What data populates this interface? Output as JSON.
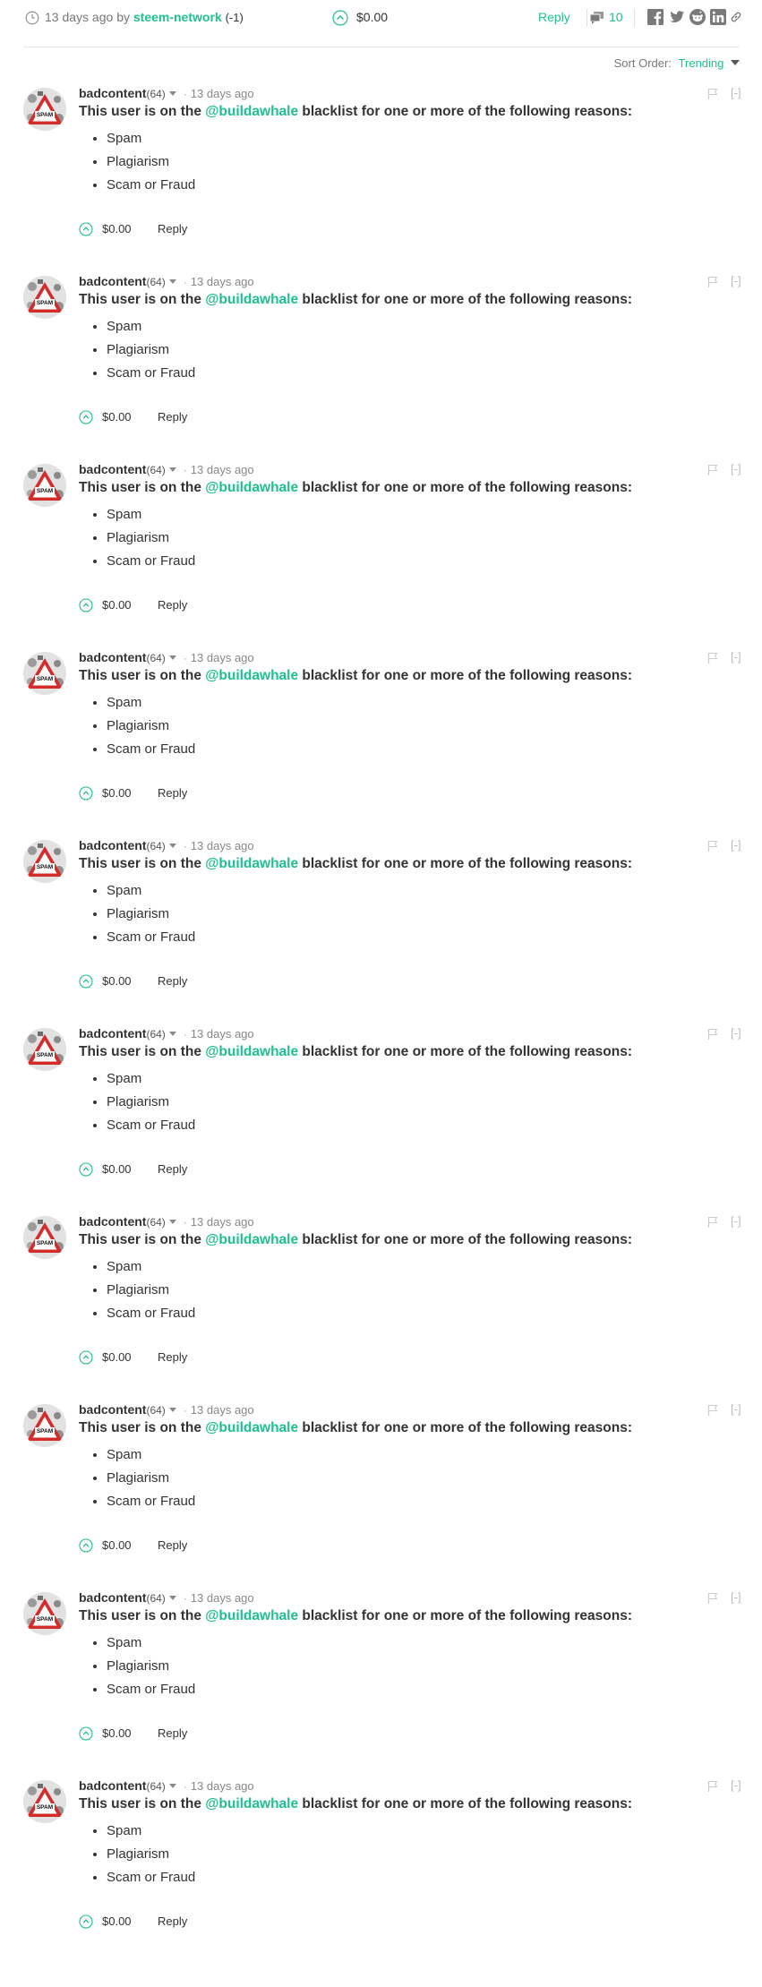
{
  "post_footer": {
    "time_ago": "13 days ago",
    "by_text": "by",
    "author": "steem-network",
    "author_rep": "(-1)",
    "payout": "$0.00",
    "reply_label": "Reply",
    "comment_count": "10"
  },
  "sort": {
    "label": "Sort Order:",
    "value": "Trending"
  },
  "colors": {
    "accent": "#1fbf8f",
    "text": "#333333",
    "muted": "#888888"
  },
  "comments": [
    {
      "author": "badcontent",
      "rep": "(64)",
      "date": "13 days ago",
      "collapse": "[-]",
      "text_before": "This user is on the",
      "mention": "@buildawhale",
      "text_after": "blacklist for one or more of the following reasons:",
      "reasons": [
        "Spam",
        "Plagiarism",
        "Scam or Fraud"
      ],
      "payout": "$0.00",
      "reply": "Reply"
    },
    {
      "author": "badcontent",
      "rep": "(64)",
      "date": "13 days ago",
      "collapse": "[-]",
      "text_before": "This user is on the",
      "mention": "@buildawhale",
      "text_after": "blacklist for one or more of the following reasons:",
      "reasons": [
        "Spam",
        "Plagiarism",
        "Scam or Fraud"
      ],
      "payout": "$0.00",
      "reply": "Reply"
    },
    {
      "author": "badcontent",
      "rep": "(64)",
      "date": "13 days ago",
      "collapse": "[-]",
      "text_before": "This user is on the",
      "mention": "@buildawhale",
      "text_after": "blacklist for one or more of the following reasons:",
      "reasons": [
        "Spam",
        "Plagiarism",
        "Scam or Fraud"
      ],
      "payout": "$0.00",
      "reply": "Reply"
    },
    {
      "author": "badcontent",
      "rep": "(64)",
      "date": "13 days ago",
      "collapse": "[-]",
      "text_before": "This user is on the",
      "mention": "@buildawhale",
      "text_after": "blacklist for one or more of the following reasons:",
      "reasons": [
        "Spam",
        "Plagiarism",
        "Scam or Fraud"
      ],
      "payout": "$0.00",
      "reply": "Reply"
    },
    {
      "author": "badcontent",
      "rep": "(64)",
      "date": "13 days ago",
      "collapse": "[-]",
      "text_before": "This user is on the",
      "mention": "@buildawhale",
      "text_after": "blacklist for one or more of the following reasons:",
      "reasons": [
        "Spam",
        "Plagiarism",
        "Scam or Fraud"
      ],
      "payout": "$0.00",
      "reply": "Reply"
    },
    {
      "author": "badcontent",
      "rep": "(64)",
      "date": "13 days ago",
      "collapse": "[-]",
      "text_before": "This user is on the",
      "mention": "@buildawhale",
      "text_after": "blacklist for one or more of the following reasons:",
      "reasons": [
        "Spam",
        "Plagiarism",
        "Scam or Fraud"
      ],
      "payout": "$0.00",
      "reply": "Reply"
    },
    {
      "author": "badcontent",
      "rep": "(64)",
      "date": "13 days ago",
      "collapse": "[-]",
      "text_before": "This user is on the",
      "mention": "@buildawhale",
      "text_after": "blacklist for one or more of the following reasons:",
      "reasons": [
        "Spam",
        "Plagiarism",
        "Scam or Fraud"
      ],
      "payout": "$0.00",
      "reply": "Reply"
    },
    {
      "author": "badcontent",
      "rep": "(64)",
      "date": "13 days ago",
      "collapse": "[-]",
      "text_before": "This user is on the",
      "mention": "@buildawhale",
      "text_after": "blacklist for one or more of the following reasons:",
      "reasons": [
        "Spam",
        "Plagiarism",
        "Scam or Fraud"
      ],
      "payout": "$0.00",
      "reply": "Reply"
    },
    {
      "author": "badcontent",
      "rep": "(64)",
      "date": "13 days ago",
      "collapse": "[-]",
      "text_before": "This user is on the",
      "mention": "@buildawhale",
      "text_after": "blacklist for one or more of the following reasons:",
      "reasons": [
        "Spam",
        "Plagiarism",
        "Scam or Fraud"
      ],
      "payout": "$0.00",
      "reply": "Reply"
    },
    {
      "author": "badcontent",
      "rep": "(64)",
      "date": "13 days ago",
      "collapse": "[-]",
      "text_before": "This user is on the",
      "mention": "@buildawhale",
      "text_after": "blacklist for one or more of the following reasons:",
      "reasons": [
        "Spam",
        "Plagiarism",
        "Scam or Fraud"
      ],
      "payout": "$0.00",
      "reply": "Reply"
    }
  ]
}
